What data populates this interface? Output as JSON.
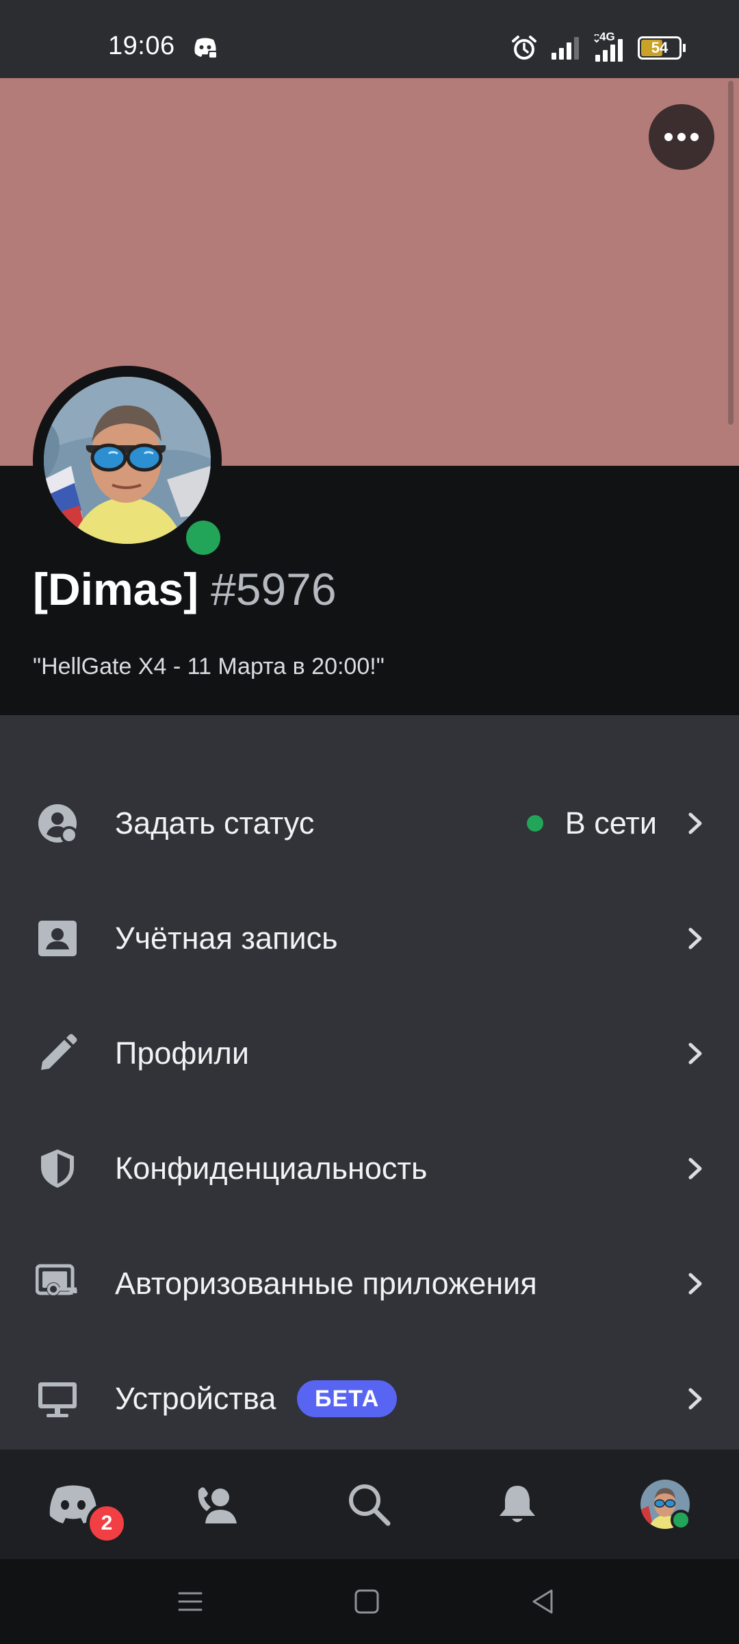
{
  "status_bar": {
    "time": "19:06",
    "network_label": "4G",
    "battery_level": "54",
    "icons": [
      "discord-notification-icon",
      "alarm-icon",
      "signal-icon",
      "signal-4g-icon",
      "battery-icon"
    ]
  },
  "profile": {
    "username": "[Dimas]",
    "discriminator": "#5976",
    "custom_status": "\"HellGate X4 - 11 Марта в 20:00!\"",
    "presence": "online",
    "banner_color": "#b47c78"
  },
  "settings": {
    "items": [
      {
        "label": "Задать статус",
        "value": "В сети",
        "icon": "status-icon"
      },
      {
        "label": "Учётная запись",
        "icon": "account-card-icon"
      },
      {
        "label": "Профили",
        "icon": "pencil-icon"
      },
      {
        "label": "Конфиденциальность",
        "icon": "shield-icon"
      },
      {
        "label": "Авторизованные приложения",
        "icon": "authorized-apps-icon"
      },
      {
        "label": "Устройства",
        "badge": "БЕТА",
        "icon": "monitor-icon"
      }
    ]
  },
  "bottom_nav": {
    "items": [
      "home-icon",
      "friends-icon",
      "search-icon",
      "notifications-icon",
      "profile-avatar"
    ],
    "home_badge": "2"
  },
  "colors": {
    "accent": "#5865f2",
    "online": "#23a559",
    "danger": "#f23f43",
    "background": "#313338"
  }
}
